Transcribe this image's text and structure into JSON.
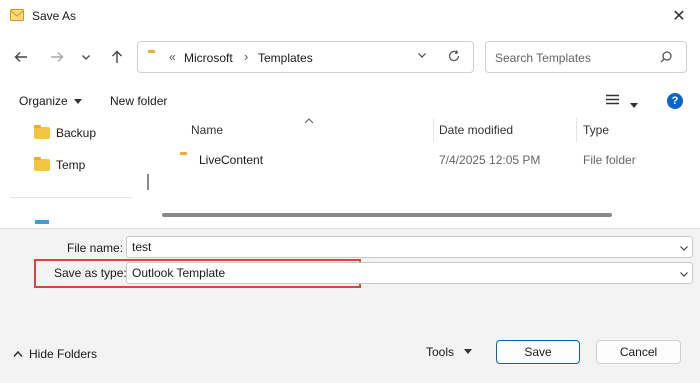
{
  "window": {
    "title": "Save As",
    "close_glyph": "✕"
  },
  "nav": {
    "breadcrumb_prefix": "«",
    "breadcrumb": [
      "Microsoft",
      "Templates"
    ],
    "search_placeholder": "Search Templates"
  },
  "toolbar": {
    "organize": "Organize",
    "new_folder": "New folder"
  },
  "sidebar": {
    "items": [
      {
        "label": "Backup"
      },
      {
        "label": "Temp"
      }
    ]
  },
  "table": {
    "headers": {
      "name": "Name",
      "date": "Date modified",
      "type": "Type"
    },
    "rows": [
      {
        "name": "LiveContent",
        "date": "7/4/2025 12:05 PM",
        "type": "File folder"
      }
    ]
  },
  "form": {
    "file_name_label": "File name:",
    "file_name_value": "test",
    "save_type_label": "Save as type:",
    "save_type_value": "Outlook Template"
  },
  "footer": {
    "hide_folders": "Hide Folders",
    "tools": "Tools",
    "save": "Save",
    "cancel": "Cancel"
  },
  "colors": {
    "highlight_border": "#d9463b",
    "help_blue": "#0a64c9",
    "folder": "#f6c445",
    "primary_border": "#0067c0"
  }
}
